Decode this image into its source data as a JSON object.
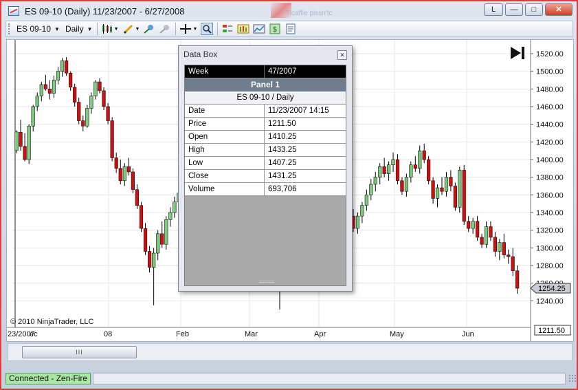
{
  "window": {
    "title": "ES 09-10 (Daily)  11/23/2007 - 6/27/2008",
    "ghost_text": "Ticaffie pissn'tc",
    "buttons": {
      "layout": "L",
      "minimize": "—",
      "maximize": "□",
      "close": "✕"
    }
  },
  "toolbar": {
    "instrument": "ES 09-10",
    "interval": "Daily",
    "icons": [
      "candlestick-icon",
      "pencil-icon",
      "add-indicator-icon",
      "remove-indicator-icon",
      "crosshair-icon",
      "zoom-icon",
      "strategy-icon",
      "chart-style-icon",
      "chart-image-icon",
      "dollar-icon",
      "properties-icon"
    ]
  },
  "chart": {
    "copyright": "© 2010 NinjaTrader, LLC",
    "colors": {
      "up": "#7ecb7e",
      "down": "#cc1111",
      "wick": "#000000",
      "grid": "#e6e6e6"
    }
  },
  "chart_data": {
    "type": "candlestick",
    "instrument": "ES 09-10",
    "interval": "Daily",
    "x_range": [
      "11/23/2007",
      "6/27/2008"
    ],
    "x_ticks": [
      "23/2007",
      "ec",
      "08",
      "Feb",
      "Mar",
      "Apr",
      "May",
      "Jun"
    ],
    "y_ticks": [
      1240,
      1260,
      1280,
      1300,
      1320,
      1340,
      1360,
      1380,
      1400,
      1420,
      1440,
      1460,
      1480,
      1500,
      1520
    ],
    "ylim": [
      1220,
      1530
    ],
    "price_markers": {
      "last": "1254.25",
      "crosshair": "1211.50"
    },
    "grid": true,
    "ohlc": [
      [
        1410.25,
        1433.25,
        1407.25,
        1431.25
      ],
      [
        1431,
        1445,
        1410,
        1415
      ],
      [
        1415,
        1430,
        1398,
        1400
      ],
      [
        1400,
        1440,
        1395,
        1438
      ],
      [
        1438,
        1462,
        1432,
        1460
      ],
      [
        1460,
        1476,
        1455,
        1472
      ],
      [
        1472,
        1488,
        1466,
        1485
      ],
      [
        1485,
        1496,
        1478,
        1480
      ],
      [
        1480,
        1490,
        1468,
        1475
      ],
      [
        1475,
        1495,
        1470,
        1490
      ],
      [
        1490,
        1505,
        1485,
        1500
      ],
      [
        1500,
        1515,
        1494,
        1512
      ],
      [
        1512,
        1516,
        1495,
        1498
      ],
      [
        1498,
        1500,
        1478,
        1482
      ],
      [
        1482,
        1486,
        1460,
        1465
      ],
      [
        1465,
        1470,
        1440,
        1444
      ],
      [
        1444,
        1450,
        1432,
        1438
      ],
      [
        1438,
        1462,
        1436,
        1458
      ],
      [
        1458,
        1476,
        1452,
        1472
      ],
      [
        1472,
        1490,
        1468,
        1488
      ],
      [
        1488,
        1492,
        1475,
        1478
      ],
      [
        1478,
        1482,
        1456,
        1460
      ],
      [
        1460,
        1464,
        1440,
        1444
      ],
      [
        1444,
        1448,
        1398,
        1402
      ],
      [
        1402,
        1408,
        1385,
        1390
      ],
      [
        1390,
        1400,
        1372,
        1376
      ],
      [
        1376,
        1396,
        1370,
        1392
      ],
      [
        1392,
        1402,
        1382,
        1386
      ],
      [
        1386,
        1390,
        1362,
        1366
      ],
      [
        1366,
        1372,
        1344,
        1348
      ],
      [
        1348,
        1352,
        1318,
        1322
      ],
      [
        1322,
        1328,
        1292,
        1296
      ],
      [
        1296,
        1302,
        1272,
        1278
      ],
      [
        1278,
        1300,
        1235,
        1294
      ],
      [
        1294,
        1320,
        1286,
        1316
      ],
      [
        1316,
        1330,
        1300,
        1304
      ],
      [
        1304,
        1336,
        1298,
        1332
      ],
      [
        1332,
        1346,
        1324,
        1340
      ],
      [
        1340,
        1358,
        1334,
        1352
      ],
      [
        1352,
        1368,
        1346,
        1362
      ],
      [
        1336,
        1344,
        1318,
        1322
      ],
      [
        1322,
        1340,
        1316,
        1336
      ],
      [
        1336,
        1352,
        1328,
        1348
      ],
      [
        1348,
        1366,
        1342,
        1360
      ],
      [
        1360,
        1378,
        1354,
        1372
      ],
      [
        1372,
        1386,
        1364,
        1380
      ],
      [
        1380,
        1396,
        1372,
        1392
      ],
      [
        1392,
        1402,
        1380,
        1384
      ],
      [
        1384,
        1398,
        1376,
        1394
      ],
      [
        1394,
        1408,
        1386,
        1400
      ],
      [
        1400,
        1406,
        1372,
        1376
      ],
      [
        1376,
        1380,
        1360,
        1364
      ],
      [
        1364,
        1384,
        1358,
        1380
      ],
      [
        1380,
        1398,
        1374,
        1394
      ],
      [
        1394,
        1404,
        1386,
        1390
      ],
      [
        1390,
        1416,
        1384,
        1410
      ],
      [
        1410,
        1418,
        1396,
        1400
      ],
      [
        1400,
        1404,
        1372,
        1376
      ],
      [
        1376,
        1380,
        1350,
        1356
      ],
      [
        1356,
        1372,
        1346,
        1368
      ],
      [
        1368,
        1380,
        1360,
        1364
      ],
      [
        1364,
        1386,
        1358,
        1380
      ],
      [
        1380,
        1388,
        1364,
        1370
      ],
      [
        1370,
        1374,
        1342,
        1346
      ],
      [
        1346,
        1392,
        1340,
        1388
      ],
      [
        1388,
        1394,
        1326,
        1330
      ],
      [
        1330,
        1336,
        1318,
        1322
      ],
      [
        1322,
        1334,
        1316,
        1330
      ],
      [
        1330,
        1336,
        1308,
        1312
      ],
      [
        1312,
        1316,
        1300,
        1304
      ],
      [
        1304,
        1330,
        1300,
        1324
      ],
      [
        1324,
        1330,
        1308,
        1312
      ],
      [
        1312,
        1318,
        1290,
        1296
      ],
      [
        1296,
        1310,
        1286,
        1306
      ],
      [
        1306,
        1316,
        1288,
        1292
      ],
      [
        1292,
        1298,
        1282,
        1290
      ],
      [
        1290,
        1300,
        1268,
        1274
      ],
      [
        1274,
        1280,
        1248,
        1254.25
      ]
    ]
  },
  "data_box": {
    "title": "Data Box",
    "close_label": "✕",
    "header": {
      "label": "Week",
      "value": "47/2007"
    },
    "panel": "Panel 1",
    "series": "ES 09-10 / Daily",
    "rows": [
      {
        "label": "Date",
        "value": "11/23/2007 14:15"
      },
      {
        "label": "Price",
        "value": "1211.50"
      },
      {
        "label": "Open",
        "value": "1410.25"
      },
      {
        "label": "High",
        "value": "1433.25"
      },
      {
        "label": "Low",
        "value": "1407.25"
      },
      {
        "label": "Close",
        "value": "1431.25"
      },
      {
        "label": "Volume",
        "value": "693,706"
      }
    ]
  },
  "scrollbar": {
    "thumb_label": "III"
  },
  "status": {
    "connection": "Connected - Zen-Fire"
  }
}
